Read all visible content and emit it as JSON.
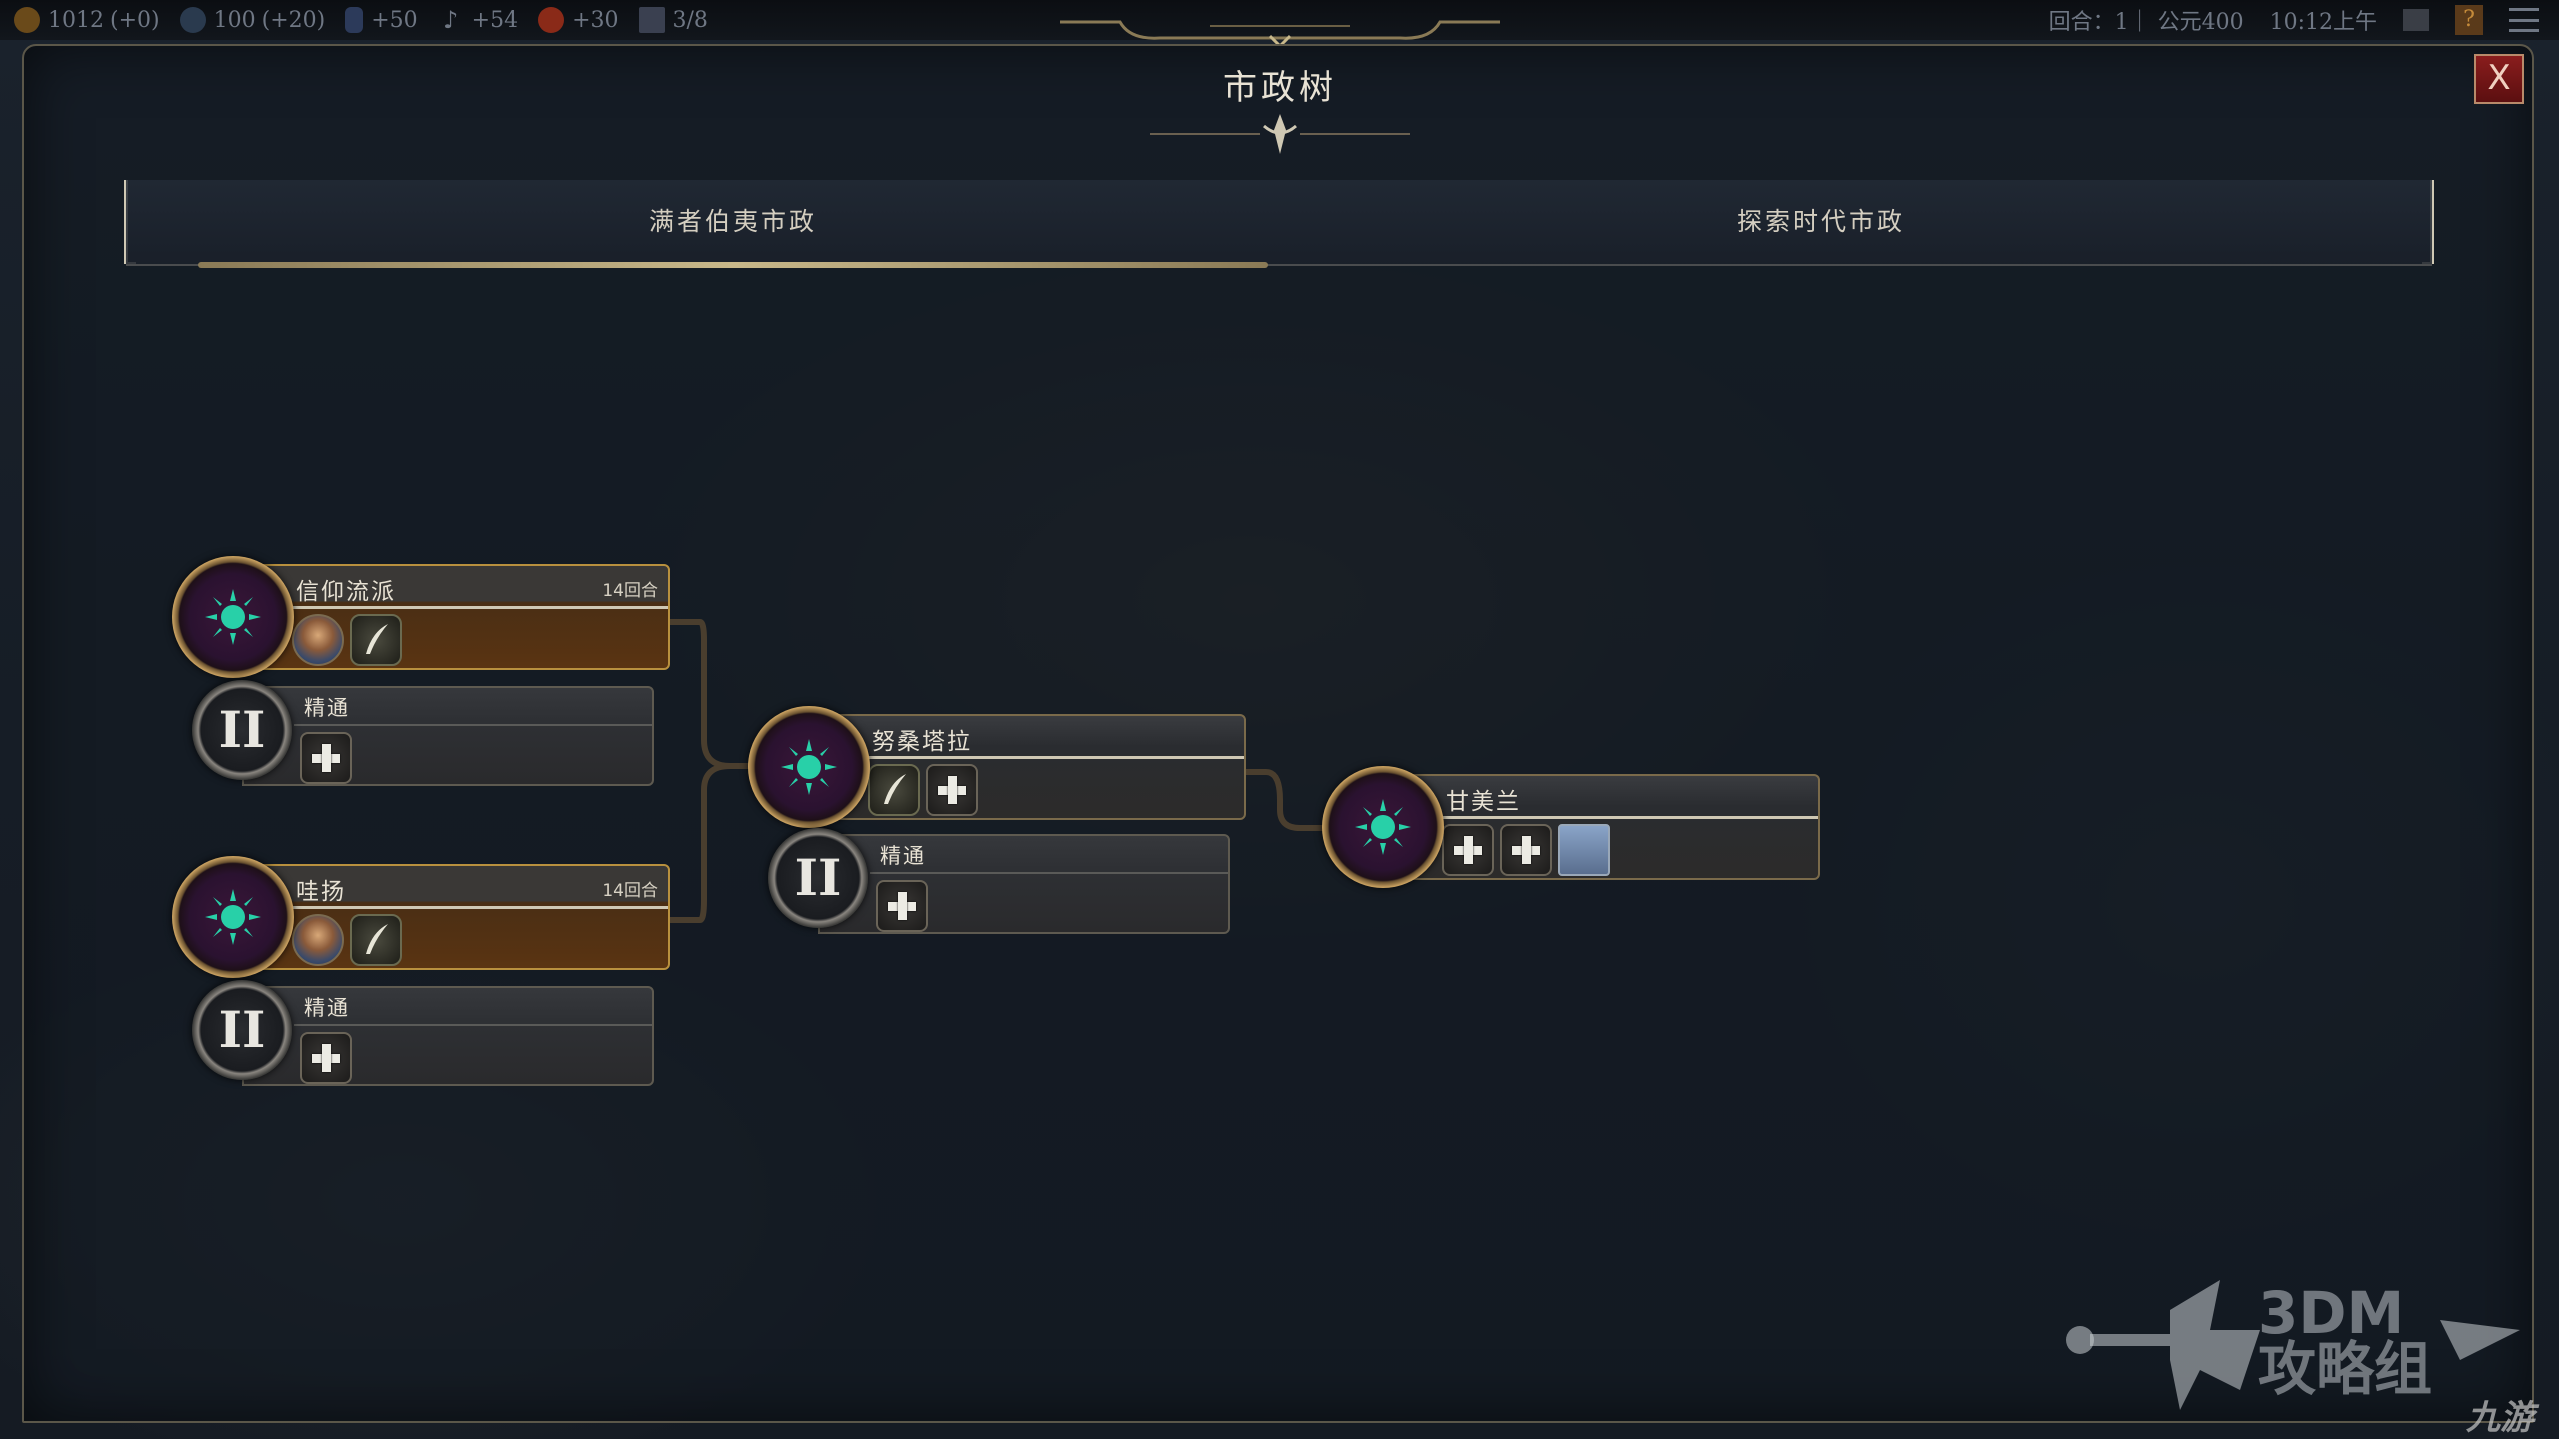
{
  "top_bar": {
    "gold": "1012",
    "gold_delta": "(+0)",
    "science": "100",
    "science_delta": "(+20)",
    "culture": "+50",
    "faith": "+54",
    "happiness": "+30",
    "cities": "3/8",
    "turn": "回合：1｜ 公元400",
    "time": "10:12上午",
    "help_label": "?"
  },
  "panel": {
    "title": "市政树",
    "close_label": "X"
  },
  "tabs": [
    {
      "label": "满者伯夷市政",
      "active": true
    },
    {
      "label": "探索时代市政",
      "active": false
    }
  ],
  "nodes": {
    "faith_school": {
      "name": "信仰流派",
      "turns": "14回合"
    },
    "faith_school_mastery": {
      "name": "精通",
      "level": "II"
    },
    "wayang": {
      "name": "哇扬",
      "turns": "14回合"
    },
    "wayang_mastery": {
      "name": "精通",
      "level": "II"
    },
    "nusantara": {
      "name": "努桑塔拉"
    },
    "nusantara_mastery": {
      "name": "精通",
      "level": "II"
    },
    "gamelan": {
      "name": "甘美兰"
    }
  },
  "watermark": {
    "text_line1": "3DM",
    "text_line2": "攻略组",
    "site": "九游"
  },
  "colors": {
    "accent_gold": "#b8903e",
    "close_red": "#8a1d1d",
    "node_teal": "#28d0a8"
  }
}
